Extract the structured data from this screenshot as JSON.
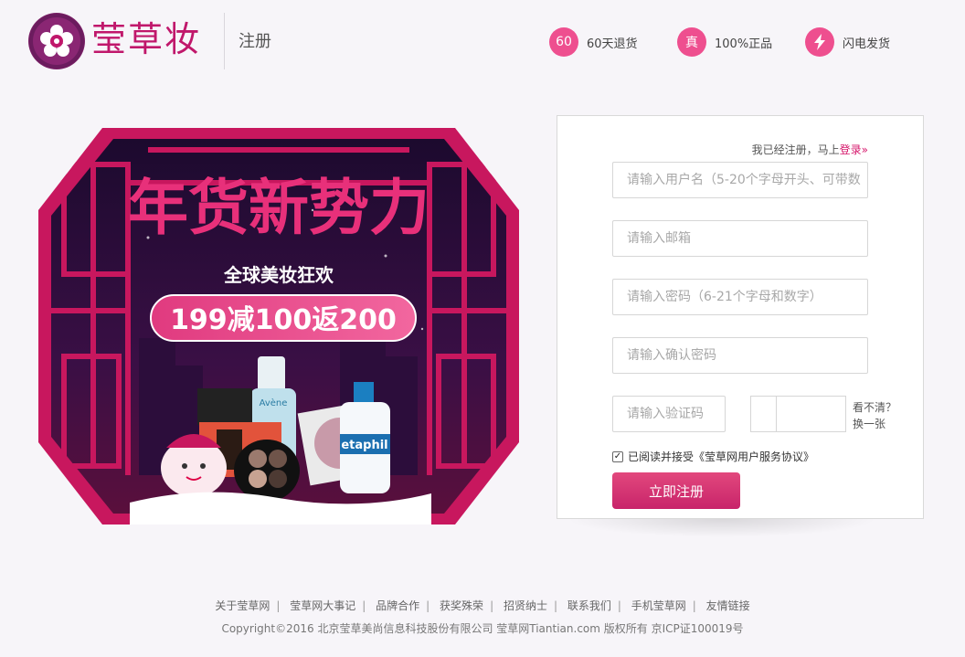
{
  "header": {
    "brand": "莹草妆",
    "page_title": "注册",
    "promises": [
      {
        "badge": "60",
        "text": "60天退货",
        "icon": "return-icon"
      },
      {
        "badge": "真",
        "text": "100%正品",
        "icon": "genuine-icon"
      },
      {
        "badge": "⚡",
        "text": "闪电发货",
        "icon": "lightning-icon"
      }
    ]
  },
  "banner": {
    "headline": "年货新势力",
    "subline": "全球美妆狂欢",
    "deal": "199减100返200",
    "product_labels": [
      "Avène",
      "etaphil"
    ]
  },
  "form": {
    "login_hint": "我已经注册，马上",
    "login_link": "登录»",
    "username_placeholder": "请输入用户名（5-20个字母开头、可带数",
    "email_placeholder": "请输入邮箱",
    "password_placeholder": "请输入密码（6-21个字母和数字）",
    "confirm_placeholder": "请输入确认密码",
    "captcha_placeholder": "请输入验证码",
    "refresh_line1": "看不清？",
    "refresh_line2": "换一张",
    "agree_text": "已阅读并接受《莹草网用户服务协议》",
    "submit_label": "立即注册"
  },
  "footer": {
    "links": [
      "关于莹草网",
      "莹草网大事记",
      "品牌合作",
      "获奖殊荣",
      "招贤纳士",
      "联系我们",
      "手机莹草网",
      "友情链接"
    ],
    "copyright": "Copyright©2016 北京莹草美尚信息科技股份有限公司 莹草网Tiantian.com 版权所有 京ICP证100019号"
  },
  "colors": {
    "brand": "#c0176b",
    "accent_pink": "#ee4f8f",
    "banner_frame": "#c8175e",
    "banner_bg": "#2a0b33"
  }
}
